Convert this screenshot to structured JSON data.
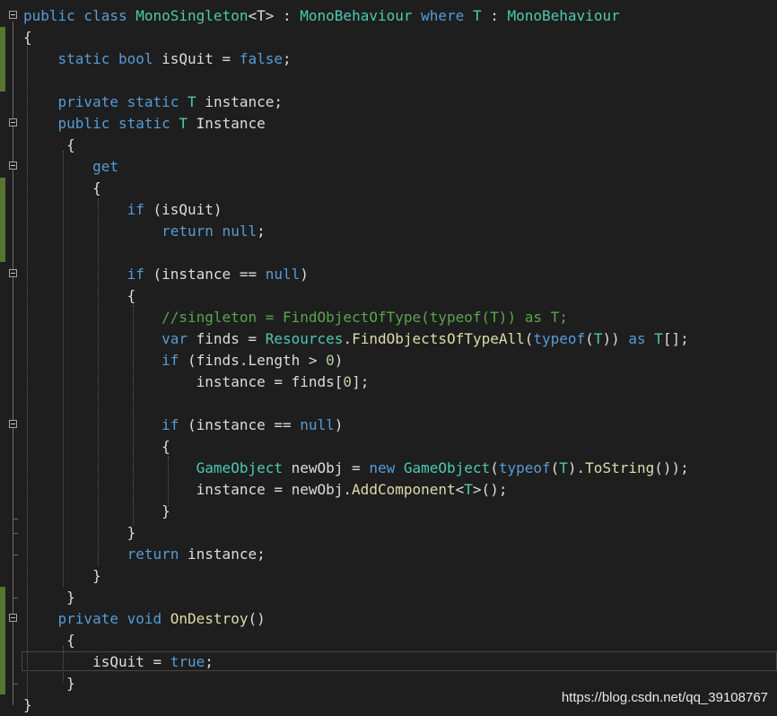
{
  "watermark": "https://blog.csdn.net/qq_39108767",
  "code": {
    "l1_a": "public class ",
    "l1_b": "MonoSingleton",
    "l1_c": "<T> : ",
    "l1_d": "MonoBehaviour",
    "l1_e": " where ",
    "l1_f": "T",
    "l1_g": " : ",
    "l1_h": "MonoBehaviour",
    "l2": "{",
    "l3_a": "    static bool ",
    "l3_b": "isQuit = ",
    "l3_c": "false",
    "l3_d": ";",
    "l5_a": "    private static ",
    "l5_b": "T",
    "l5_c": " instance;",
    "l6_a": "    public static ",
    "l6_b": "T",
    "l6_c": " Instance",
    "l7": "     {",
    "l8": "        get",
    "l9": "        {",
    "l10_a": "            if",
    "l10_b": " (isQuit)",
    "l11_a": "                return null",
    "l11_b": ";",
    "l13_a": "            if",
    "l13_b": " (instance == ",
    "l13_c": "null",
    "l13_d": ")",
    "l14": "            {",
    "l15": "                //singleton = FindObjectOfType(typeof(T)) as T;",
    "l16_a": "                var",
    "l16_b": " finds = ",
    "l16_c": "Resources",
    "l16_d": ".",
    "l16_e": "FindObjectsOfTypeAll",
    "l16_f": "(",
    "l16_g": "typeof",
    "l16_h": "(",
    "l16_i": "T",
    "l16_j": ")) ",
    "l16_k": "as",
    "l16_l": " ",
    "l16_m": "T",
    "l16_n": "[];",
    "l17_a": "                if",
    "l17_b": " (finds.Length > ",
    "l17_c": "0",
    "l17_d": ")",
    "l18_a": "                    instance = finds[",
    "l18_b": "0",
    "l18_c": "];",
    "l20_a": "                if",
    "l20_b": " (instance == ",
    "l20_c": "null",
    "l20_d": ")",
    "l21": "                {",
    "l22_a": "                    ",
    "l22_b": "GameObject",
    "l22_c": " newObj = ",
    "l22_d": "new",
    "l22_e": " ",
    "l22_f": "GameObject",
    "l22_g": "(",
    "l22_h": "typeof",
    "l22_i": "(",
    "l22_j": "T",
    "l22_k": ").",
    "l22_l": "ToString",
    "l22_m": "());",
    "l23_a": "                    instance = newObj.",
    "l23_b": "AddComponent",
    "l23_c": "<",
    "l23_d": "T",
    "l23_e": ">();",
    "l24": "                }",
    "l25": "            }",
    "l26_a": "            return",
    "l26_b": " instance;",
    "l27": "        }",
    "l28": "     }",
    "l29_a": "    private void ",
    "l29_b": "OnDestroy",
    "l29_c": "()",
    "l30": "     {",
    "l31_a": "        isQuit = ",
    "l31_b": "true",
    "l31_c": ";",
    "l32": "     }",
    "l33": "}"
  }
}
